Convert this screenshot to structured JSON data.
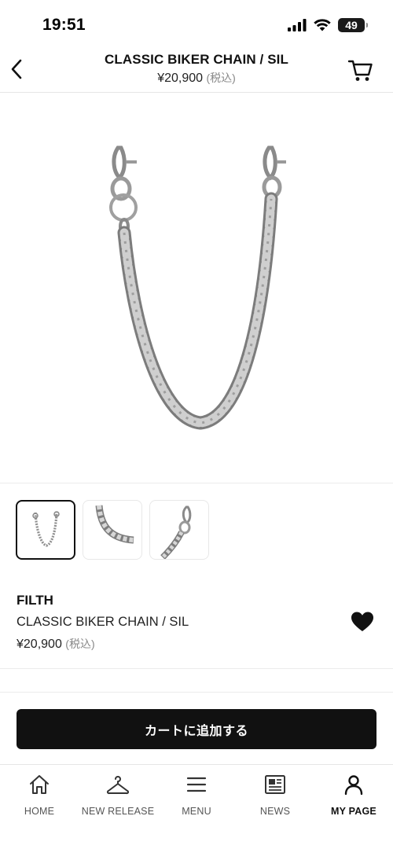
{
  "status_bar": {
    "time": "19:51",
    "battery": "49"
  },
  "header": {
    "title": "CLASSIC BIKER CHAIN / SIL",
    "price": "¥20,900",
    "tax_note": "(税込)",
    "icons": {
      "back": "chevron-left-icon",
      "cart": "cart-icon"
    }
  },
  "product": {
    "brand": "FILTH",
    "name": "CLASSIC BIKER CHAIN / SIL",
    "price": "¥20,900",
    "tax_note": "(税込)",
    "favorite": true,
    "thumbnails": [
      "full-chain",
      "chain-links-closeup",
      "clasp-closeup"
    ],
    "selected_thumbnail": 0
  },
  "actions": {
    "add_to_cart": "カートに追加する"
  },
  "bottom_nav": {
    "items": [
      {
        "label": "HOME",
        "icon": "home-icon"
      },
      {
        "label": "NEW RELEASE",
        "icon": "hanger-icon"
      },
      {
        "label": "MENU",
        "icon": "menu-icon"
      },
      {
        "label": "NEWS",
        "icon": "news-icon"
      },
      {
        "label": "MY PAGE",
        "icon": "user-icon"
      }
    ],
    "active_index": 4
  },
  "colors": {
    "primary": "#111111",
    "divider": "#ececec",
    "muted": "#888888"
  }
}
